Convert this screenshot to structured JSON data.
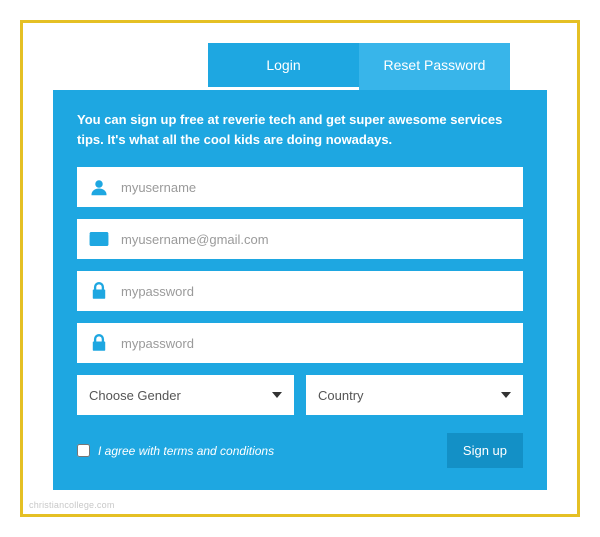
{
  "tabs": {
    "login": "Login",
    "reset": "Reset Password"
  },
  "intro": "You can sign up free at reverie tech and get super awesome services tips. It's what all the cool kids are doing nowadays.",
  "fields": {
    "username_placeholder": "myusername",
    "email_placeholder": "myusername@gmail.com",
    "password_placeholder": "mypassword",
    "confirm_placeholder": "mypassword"
  },
  "selects": {
    "gender_label": "Choose Gender",
    "country_label": "Country"
  },
  "agree_label": "I agree with terms and conditions",
  "signup_label": "Sign up",
  "watermark": "christiancollege.com"
}
